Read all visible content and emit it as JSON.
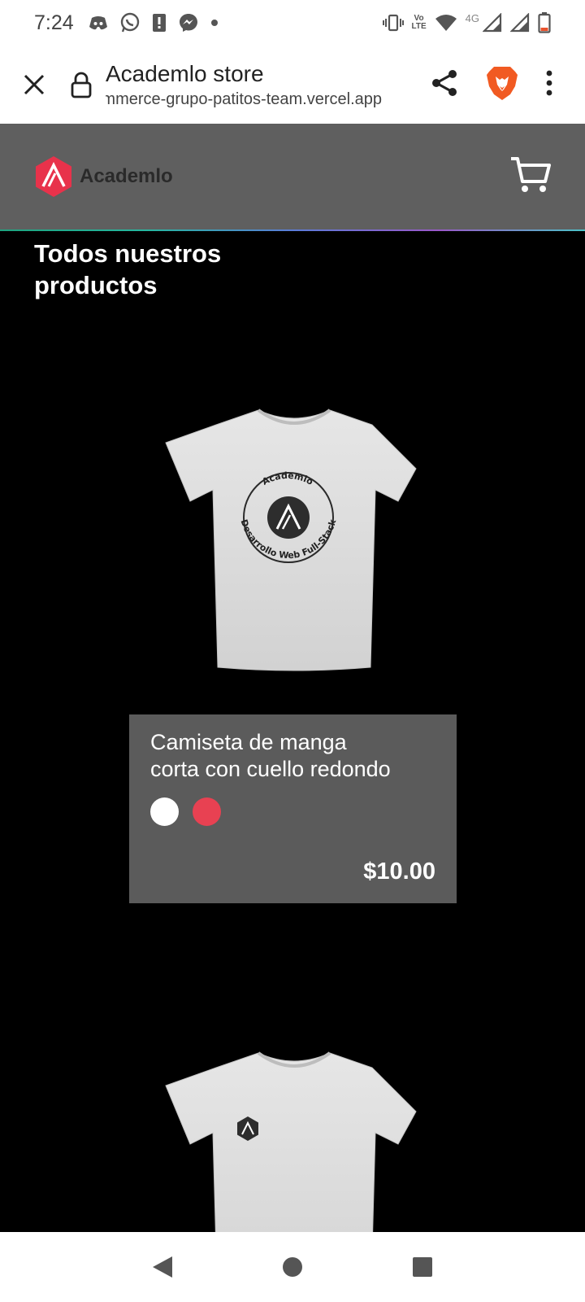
{
  "status_bar": {
    "time": "7:24",
    "network_label_top": "Vo",
    "network_label_bottom": "LTE",
    "network_type": "4G",
    "icons": [
      "discord-icon",
      "whatsapp-icon",
      "alert-icon",
      "messenger-icon",
      "dot-icon",
      "vibrate-icon",
      "volte-icon",
      "wifi-icon",
      "signal-icon",
      "signal-icon",
      "battery-icon"
    ]
  },
  "browser": {
    "page_title": "Academlo store",
    "url": "ecommerce-grupo-patitos-team.vercel.app",
    "url_visible": "‎nerce-grupo-patitos-team.vercel.app",
    "icons": [
      "close-icon",
      "lock-icon",
      "share-icon",
      "brave-lion-icon",
      "more-vert-icon"
    ]
  },
  "header": {
    "brand_name": "Academlo",
    "logo_letter": "A",
    "brand_color": "#e8324b",
    "header_bg": "#5f5f5f"
  },
  "main": {
    "section_title": "Todos nuestros productos",
    "products": [
      {
        "name": "Camiseta de manga corta con cuello redondo",
        "price": "$10.00",
        "colors": [
          "#ffffff",
          "#e84152"
        ],
        "print_top": "Academlo",
        "print_bottom": "Desarrollo Web Full-Stack"
      },
      {
        "name": "",
        "print_top": "",
        "print_bottom": ""
      }
    ]
  },
  "nav_bar": {
    "buttons": [
      "back-icon",
      "home-icon",
      "recents-icon"
    ]
  }
}
